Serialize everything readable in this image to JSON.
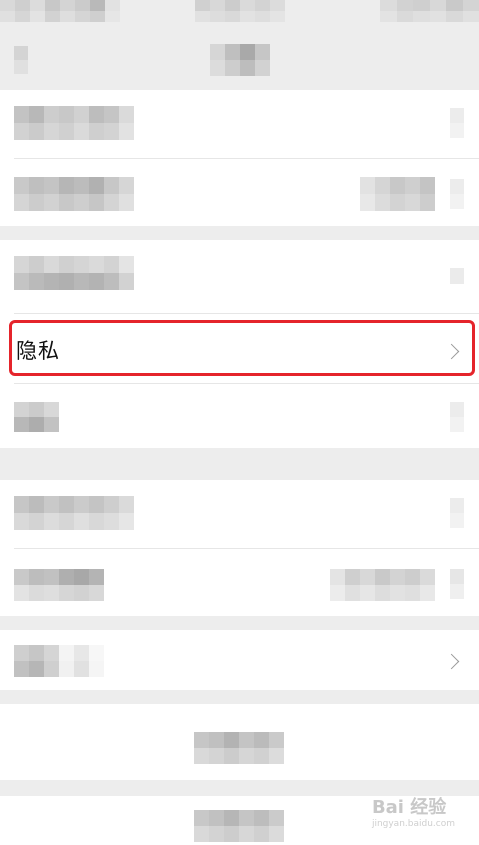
{
  "settings": {
    "privacy_label": "隐私"
  },
  "watermark": {
    "brand": "Bai 经验",
    "url": "jingyan.baidu.com"
  },
  "colors": {
    "highlight": "#e5242b",
    "background": "#ededed",
    "row": "#ffffff"
  },
  "icons": {
    "chevron": "chevron-right-icon"
  }
}
